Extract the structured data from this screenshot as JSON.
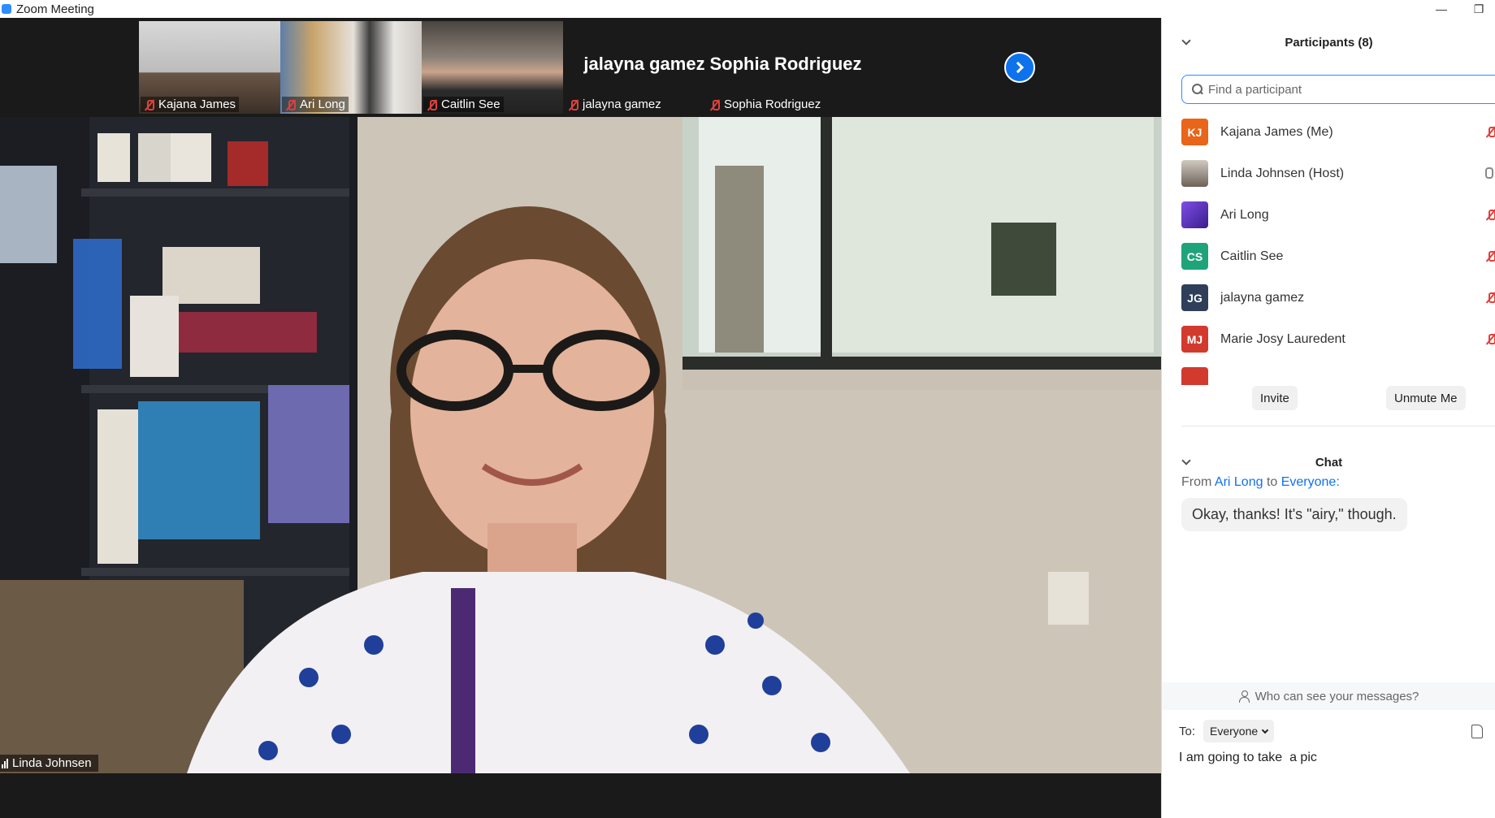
{
  "window": {
    "title": "Zoom Meeting",
    "minimize": "—",
    "restore": "❐"
  },
  "thumbnails": [
    {
      "name": "Kajana James",
      "type": "video",
      "colors": [
        "#c9c9c9",
        "#5c4a3a"
      ]
    },
    {
      "name": "Ari Long",
      "type": "video",
      "colors": [
        "#d0d8e0",
        "#4b5f7a"
      ]
    },
    {
      "name": "Caitlin See",
      "type": "video",
      "colors": [
        "#7a7268",
        "#2a2a2a"
      ]
    },
    {
      "name": "jalayna gamez",
      "type": "name",
      "display": "jalayna gamez"
    },
    {
      "name": "Sophia Rodriguez",
      "type": "name",
      "display": "Sophia Rodriguez"
    }
  ],
  "main_video": {
    "speaker": "Linda Johnsen"
  },
  "participants": {
    "title": "Participants (8)",
    "search_placeholder": "Find a participant",
    "list": [
      {
        "initials": "KJ",
        "name": "Kajana James (Me)",
        "color": "#e8651a",
        "muted": true
      },
      {
        "initials": "",
        "name": "Linda Johnsen (Host)",
        "color": "#9a8f85",
        "muted": false
      },
      {
        "initials": "",
        "name": "Ari Long",
        "color": "#6a3bd1",
        "muted": true
      },
      {
        "initials": "CS",
        "name": "Caitlin See",
        "color": "#1fa37a",
        "muted": true
      },
      {
        "initials": "JG",
        "name": "jalayna gamez",
        "color": "#2f3f5a",
        "muted": true
      },
      {
        "initials": "MJ",
        "name": "Marie Josy Lauredent",
        "color": "#d23a2e",
        "muted": true
      }
    ],
    "invite_label": "Invite",
    "unmute_label": "Unmute Me"
  },
  "chat": {
    "title": "Chat",
    "from_prefix": "From",
    "from_sender": "Ari Long",
    "from_to": "to",
    "from_recipient": "Everyone:",
    "message": "Okay, thanks!  It's \"airy,\" though.",
    "who_can_see": "Who can see your messages?",
    "to_label": "To:",
    "to_value": "Everyone",
    "draft": "I am going to take  a pic"
  }
}
